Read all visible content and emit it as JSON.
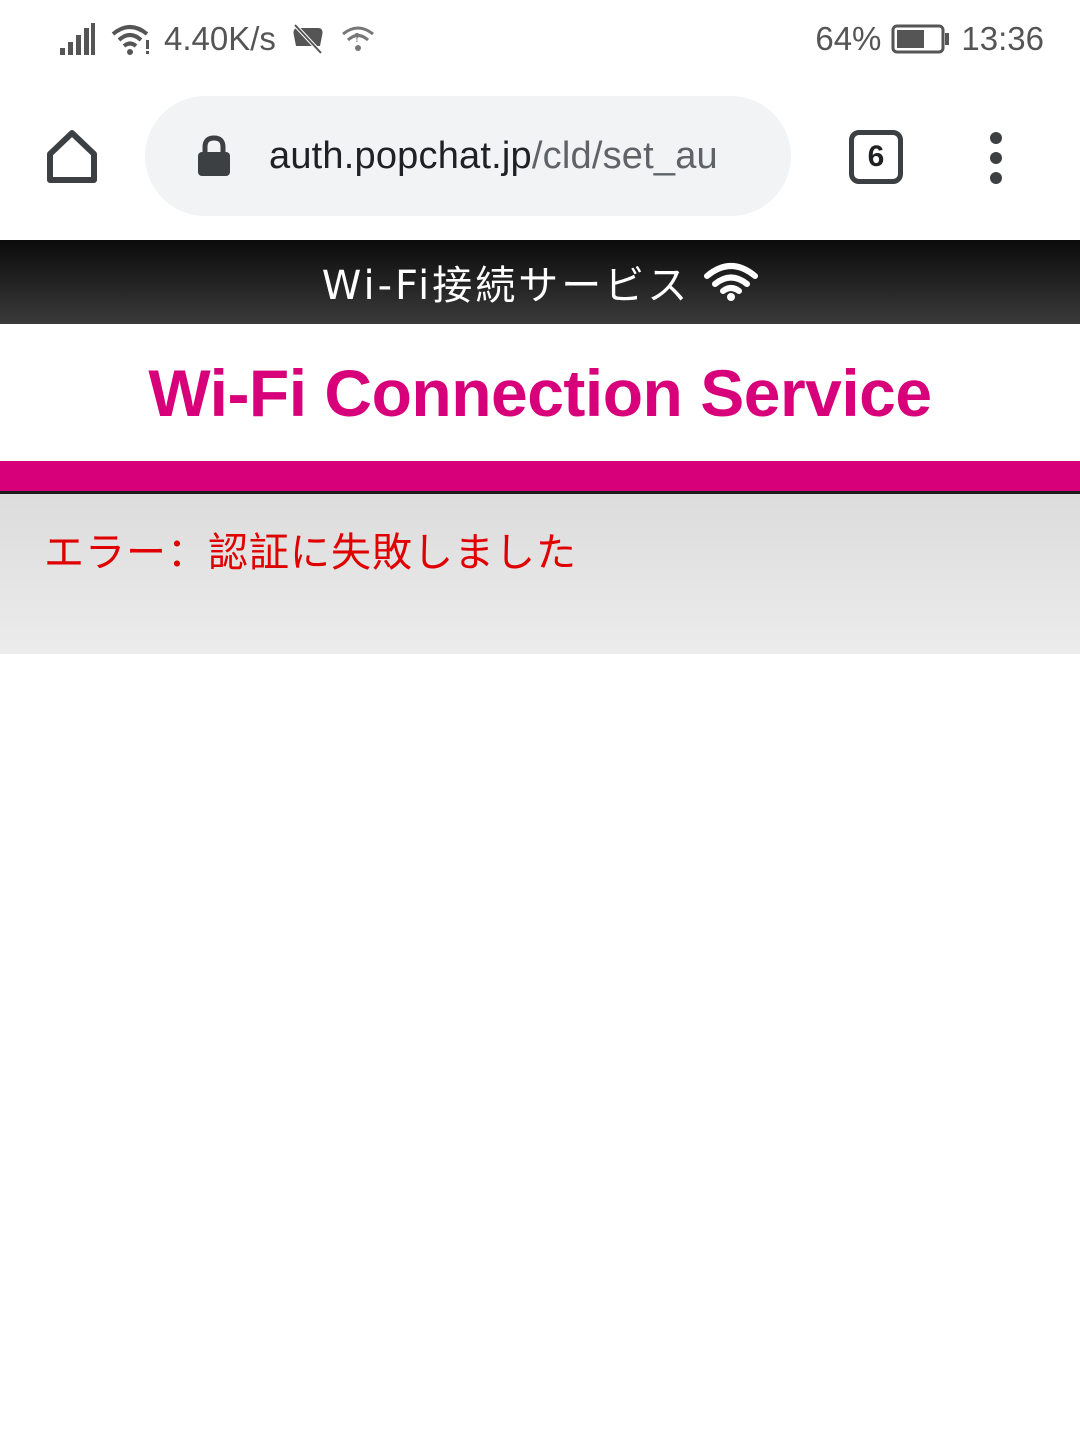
{
  "status_bar": {
    "network_speed": "4.40K/s",
    "battery_percent": "64%",
    "battery_level": 0.64,
    "time": "13:36",
    "icons": [
      "signal-icon",
      "wifi-icon",
      "mute-icon",
      "wifi-hotspot-icon",
      "battery-icon"
    ]
  },
  "browser": {
    "url_host": "auth.popchat.jp",
    "url_path": "/cld/set_au",
    "tab_count": "6",
    "icons": [
      "home-icon",
      "lock-icon",
      "tabs-icon",
      "more-vert-icon"
    ]
  },
  "page": {
    "header_title": "Wi-Fi接続サービス",
    "brand_title": "Wi-Fi Connection Service",
    "error_message": "エラー：認証に失敗しました"
  },
  "colors": {
    "brand": "#d8007a",
    "error": "#e00000",
    "header_bg": "#1a1a1a",
    "panel_bg": "#e4e4e4"
  }
}
